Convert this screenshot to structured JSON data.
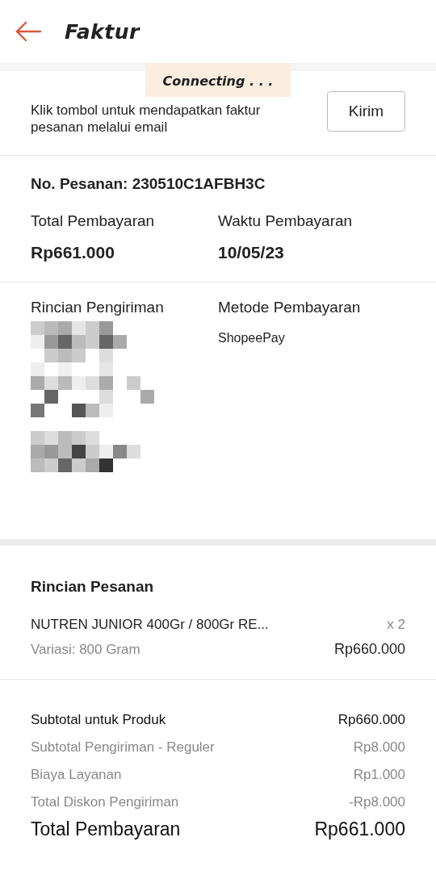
{
  "header": {
    "title": "Faktur"
  },
  "toast": {
    "text": "Connecting . . ."
  },
  "email_request": {
    "text": "Klik tombol untuk mendapatkan faktur pesanan melalui email",
    "button": "Kirim"
  },
  "order": {
    "number": "No. Pesanan: 230510C1AFBH3C",
    "fields": [
      {
        "label": "Total Pembayaran",
        "value": "Rp661.000"
      },
      {
        "label": "Waktu Pembayaran",
        "value": "10/05/23"
      }
    ]
  },
  "details": {
    "shipping_label": "Rincian Pengiriman",
    "payment_label": "Metode Pembayaran",
    "payment_method": "ShopeePay"
  },
  "order_details": {
    "title": "Rincian Pesanan",
    "items": [
      {
        "name": "NUTREN JUNIOR 400Gr / 800Gr RE...",
        "quantity": "x 2",
        "variation": "Variasi: 800 Gram",
        "price": "Rp660.000"
      }
    ]
  },
  "summary": [
    {
      "kind": "main",
      "label": "Subtotal untuk Produk",
      "value": "Rp660.000"
    },
    {
      "kind": "minor",
      "label": "Subtotal Pengiriman - Reguler",
      "value": "Rp8.000"
    },
    {
      "kind": "minor",
      "label": "Biaya Layanan",
      "value": "Rp1.000"
    },
    {
      "kind": "minor",
      "label": "Total Diskon Pengiriman",
      "value": "-Rp8.000"
    },
    {
      "kind": "total",
      "label": "Total Pembayaran",
      "value": "Rp661.000"
    }
  ]
}
